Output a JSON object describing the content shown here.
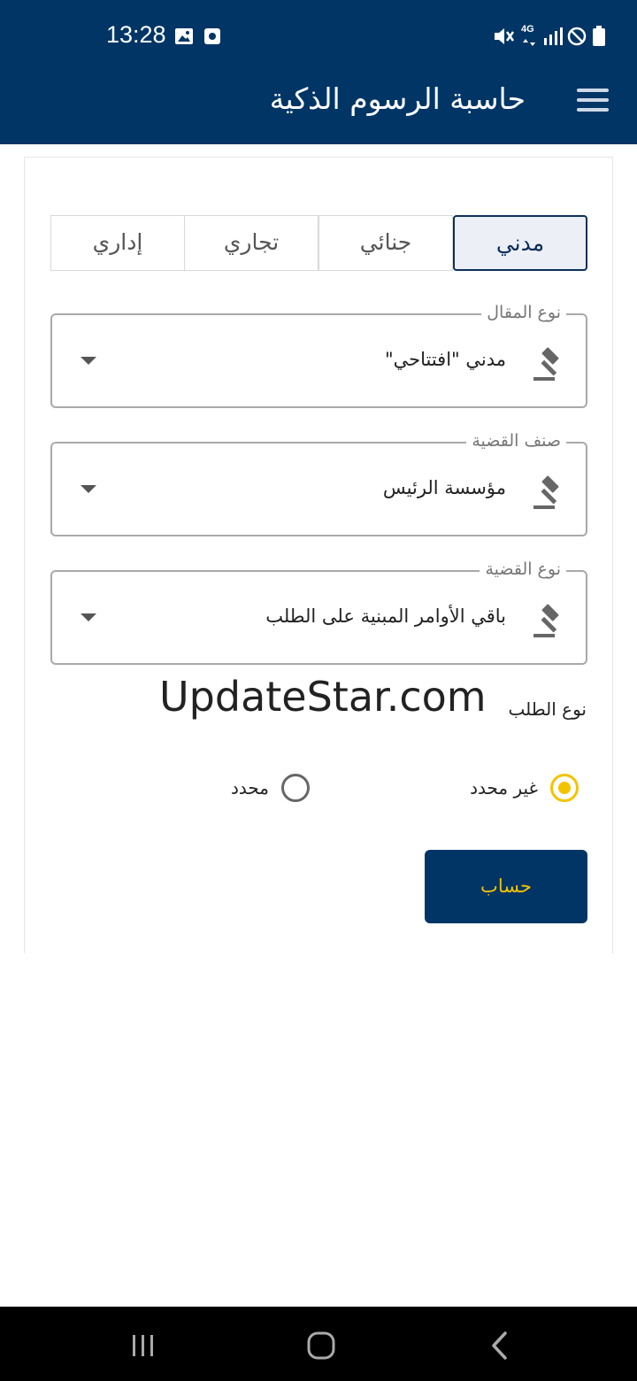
{
  "status_bar": {
    "time": "13:28",
    "network_label": "4G"
  },
  "app_bar": {
    "title": "حاسبة الرسوم الذكية",
    "menu_icon": "hamburger-menu-icon"
  },
  "tabs": [
    {
      "label": "مدني",
      "active": true
    },
    {
      "label": "جنائي",
      "active": false
    },
    {
      "label": "تجاري",
      "active": false
    },
    {
      "label": "إداري",
      "active": false
    }
  ],
  "fields": {
    "article_type": {
      "label": "نوع المقال",
      "value": "مدني \"افتتاحي\""
    },
    "case_class": {
      "label": "صنف القضية",
      "value": "مؤسسة الرئيس"
    },
    "case_type": {
      "label": "نوع القضية",
      "value": "باقي الأوامر المبنية على الطلب"
    }
  },
  "field_icon": "gavel-icon",
  "watermark": "UpdateStar.com",
  "request_type": {
    "label": "نوع الطلب",
    "options": [
      {
        "label": "غير محدد",
        "selected": true
      },
      {
        "label": "محدد",
        "selected": false
      }
    ]
  },
  "calculate_button": "حساب",
  "colors": {
    "primary": "#003566",
    "accent": "#f3c300"
  }
}
